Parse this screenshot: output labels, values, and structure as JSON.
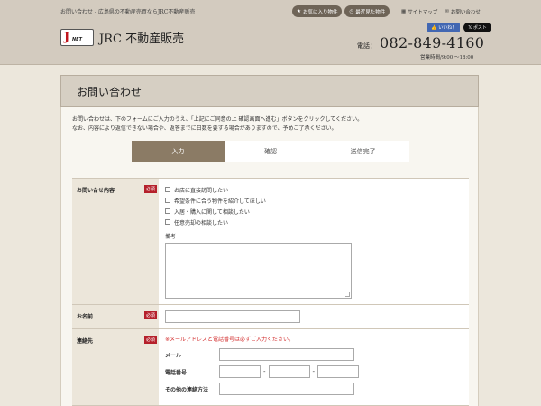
{
  "header": {
    "tagline": "お問い合わせ - 広島県の不動産売買ならJRC不動産販売",
    "favorites_label": "お気に入り物件",
    "recent_label": "最近見た物件",
    "sitemap_label": "サイトマップ",
    "contact_label": "お問い合わせ",
    "logo_j": "J",
    "logo_net": "NET",
    "logo_text": "JRC 不動産販売",
    "fb_label": "いいね！",
    "tw_label": "ポスト",
    "phone_label": "電話：",
    "phone_number": "082-849-4160",
    "hours": "営業時間/9:00 ～18:00"
  },
  "page": {
    "title": "お問い合わせ",
    "intro_1": "お問い合わせは、下のフォームにご入力のうえ、「上記にご同意の上 確認画面へ進む」ボタンをクリックしてください。",
    "intro_2": "なお、内容により返信できない場合や、返答までに日数を要する場合がありますので、予めご了承ください。"
  },
  "steps": [
    "入力",
    "確認",
    "送信完了"
  ],
  "form": {
    "required_badge": "必須",
    "inquiry": {
      "label": "お問い合せ内容",
      "options": [
        "お店に直接訪問したい",
        "希望条件に合う物件を紹介してほしい",
        "入居・購入に関して相談したい",
        "任意売却の相談したい"
      ],
      "note_label": "備考"
    },
    "name": {
      "label": "お名前",
      "value": ""
    },
    "contact": {
      "label": "連絡先",
      "warning": "※メールアドレスと電話番号は必ずご入力ください。",
      "email_label": "メール",
      "phone_label": "電話番号",
      "phone_sep": "-",
      "other_label": "その他の連絡方法"
    }
  },
  "colors": {
    "header_bg": "#d3cbbf",
    "step_active": "#8b7b65",
    "required": "#b5202b",
    "warning": "#d32f2f"
  }
}
